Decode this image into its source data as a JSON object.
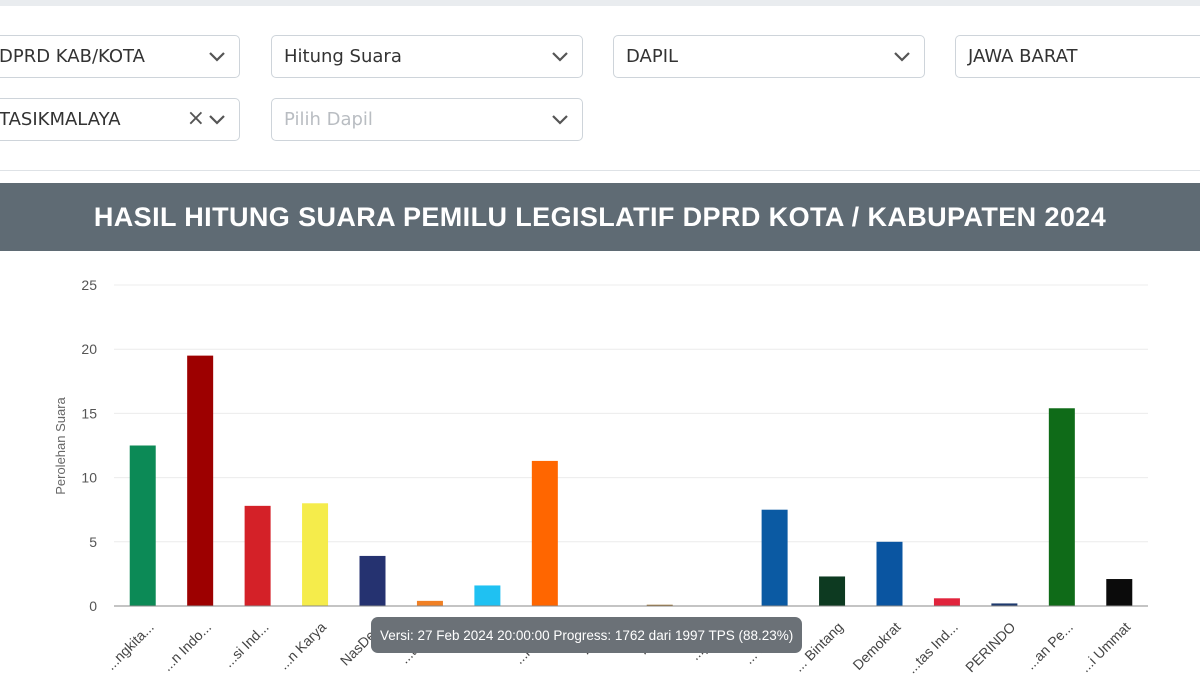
{
  "filters": {
    "row1": [
      {
        "name": "election-type-select",
        "value": "DPRD KAB/KOTA"
      },
      {
        "name": "count-type-select",
        "value": "Hitung Suara"
      },
      {
        "name": "region-level-select",
        "value": "DAPIL"
      },
      {
        "name": "province-select",
        "value": "JAWA BARAT"
      }
    ],
    "row2": [
      {
        "name": "regency-select",
        "value": "TASIKMALAYA"
      },
      {
        "name": "dapil-select",
        "placeholder": "Pilih Dapil"
      }
    ]
  },
  "banner": {
    "title": "HASIL HITUNG SUARA PEMILU LEGISLATIF DPRD KOTA / KABUPATEN 2024"
  },
  "tooltip": {
    "text": "Versi: 27 Feb 2024 20:00:00 Progress: 1762 dari 1997 TPS (88.23%)"
  },
  "chart_data": {
    "type": "bar",
    "title": "",
    "ylabel": "Perolehan Suara",
    "ylim": [
      0,
      25
    ],
    "yticks": [
      0,
      5,
      10,
      15,
      20,
      25
    ],
    "grid": true,
    "categories": [
      "...ngkita...",
      "...n Indo...",
      "...si Ind...",
      "...n Karya",
      "NasDem",
      "...tai B...",
      "...ang",
      "...n Se...",
      "...kura",
      "...rami",
      "...pub...",
      "... Nas...",
      "... Bintang",
      "Demokrat",
      "...tas Ind...",
      "PERINDO",
      "...an Pe...",
      "...i Ummat"
    ],
    "values": [
      12.5,
      19.5,
      7.8,
      8.0,
      3.9,
      0.4,
      1.6,
      11.3,
      0.0,
      0.1,
      0.0,
      7.5,
      2.3,
      5.0,
      0.6,
      0.2,
      15.4,
      2.1
    ],
    "colors": [
      "#0c8a56",
      "#9d0000",
      "#d42128",
      "#f5ec4b",
      "#253270",
      "#f08025",
      "#1fc1f2",
      "#ff6600",
      "#e7c513",
      "#9a6f2f",
      "#b8141b",
      "#0b5aa3",
      "#0d3a21",
      "#0a55a1",
      "#e1243c",
      "#1e3a6e",
      "#0f6b18",
      "#0b0b0b"
    ]
  }
}
